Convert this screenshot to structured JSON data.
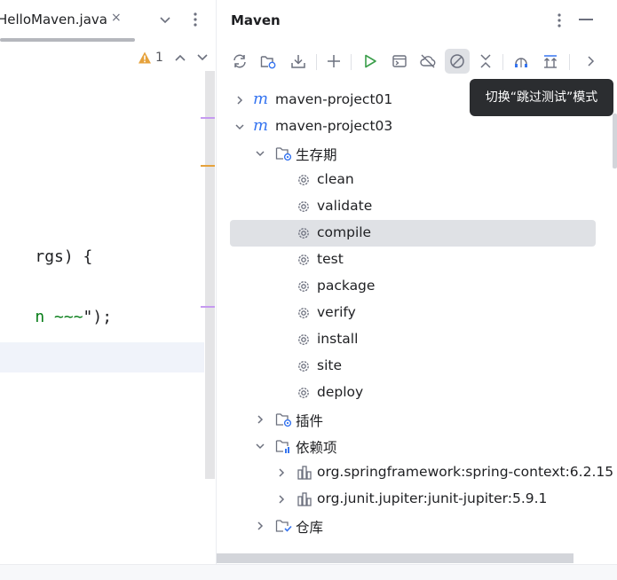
{
  "editor": {
    "tab": {
      "title": "HelloMaven.java",
      "close": "×"
    },
    "inspections": {
      "warning_count": "1"
    },
    "code_lines": [
      {
        "text": "rgs) {",
        "string_part": "",
        "tail": ""
      },
      {
        "text": "n ~~~",
        "string_part": "n ~~~",
        "tail": "\");"
      }
    ]
  },
  "maven": {
    "title": "Maven",
    "tooltip": "切换“跳过测试”模式",
    "toolbar": [
      {
        "icon": "reload-icon"
      },
      {
        "icon": "generate-sources-icon"
      },
      {
        "icon": "download-icon"
      },
      {
        "icon": "add-icon"
      },
      {
        "icon": "run-icon"
      },
      {
        "icon": "execute-goal-icon"
      },
      {
        "icon": "offline-mode-icon"
      },
      {
        "icon": "skip-tests-icon",
        "active": true
      },
      {
        "icon": "collapse-all-icon"
      },
      {
        "icon": "show-dependencies-icon"
      },
      {
        "icon": "analyze-dependencies-icon"
      },
      {
        "icon": "more-chevron-icon"
      }
    ],
    "tree": {
      "project1": {
        "label": "maven-project01"
      },
      "project3": {
        "label": "maven-project03"
      },
      "lifecycle": {
        "label": "生存期",
        "goals": [
          "clean",
          "validate",
          "compile",
          "test",
          "package",
          "verify",
          "install",
          "site",
          "deploy"
        ],
        "selected": "compile"
      },
      "plugins": {
        "label": "插件"
      },
      "dependencies": {
        "label": "依赖项",
        "items": [
          "org.springframework:spring-context:6.2.15",
          "org.junit.jupiter:junit-jupiter:5.9.1"
        ]
      },
      "repositories": {
        "label": "仓库"
      }
    }
  },
  "colors": {
    "accent": "#3574f0",
    "run_green": "#3a9e4a",
    "warning": "#e6a23c",
    "marker_purple": "#c69af0",
    "marker_orange": "#e6a23c",
    "tooltip_bg": "#2b2d30"
  }
}
